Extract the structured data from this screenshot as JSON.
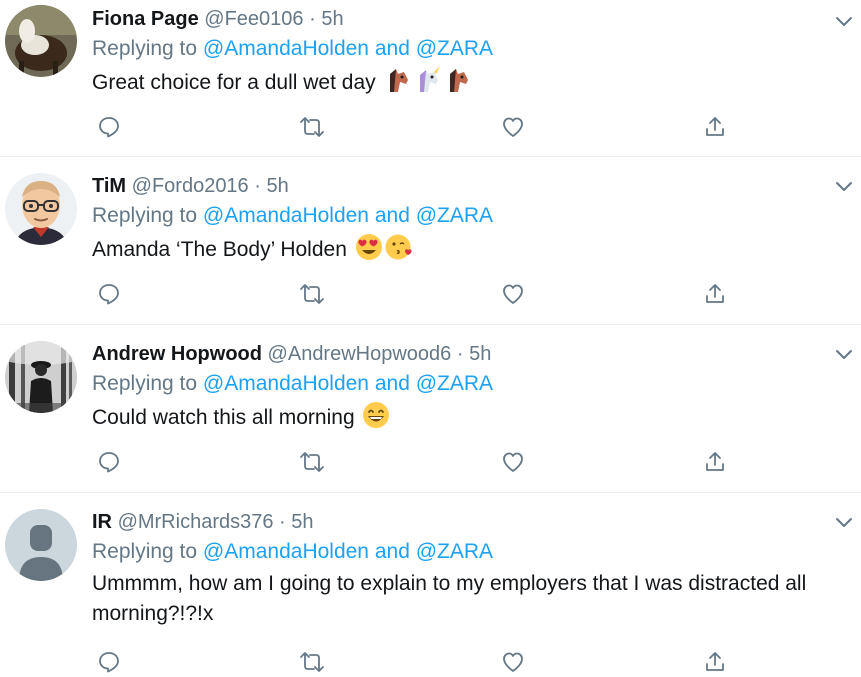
{
  "colors": {
    "link": "#1da1f2",
    "secondary": "#657786",
    "text": "#14171a",
    "divider": "#e6ecf0"
  },
  "tweets": [
    {
      "name": "Fiona Page",
      "handle": "@Fee0106",
      "separator": "·",
      "time": "5h",
      "replying_prefix": "Replying to",
      "mention1": "@AmandaHolden",
      "conj": "and",
      "mention2": "@ZARA",
      "text": "Great choice for a dull wet day",
      "emojis": [
        "horse-face",
        "unicorn-face",
        "horse-face"
      ],
      "avatar": "horse-photo"
    },
    {
      "name": "TiM",
      "handle": "@Fordo2016",
      "separator": "·",
      "time": "5h",
      "replying_prefix": "Replying to",
      "mention1": "@AmandaHolden",
      "conj": "and",
      "mention2": "@ZARA",
      "text": "Amanda ‘The Body’ Holden",
      "emojis": [
        "heart-eyes-face",
        "kissing-face"
      ],
      "avatar": "bitmoji-glasses"
    },
    {
      "name": "Andrew Hopwood",
      "handle": "@AndrewHopwood6",
      "separator": "·",
      "time": "5h",
      "replying_prefix": "Replying to",
      "mention1": "@AmandaHolden",
      "conj": "and",
      "mention2": "@ZARA",
      "text": "Could watch this all morning",
      "emojis": [
        "grinning-face"
      ],
      "avatar": "forest-photo"
    },
    {
      "name": "IR",
      "handle": "@MrRichards376",
      "separator": "·",
      "time": "5h",
      "replying_prefix": "Replying to",
      "mention1": "@AmandaHolden",
      "conj": "and",
      "mention2": "@ZARA",
      "text": "Ummmm, how am I going to explain to my employers that I was distracted all morning?!?!x",
      "emojis": [],
      "avatar": "default-profile"
    }
  ]
}
